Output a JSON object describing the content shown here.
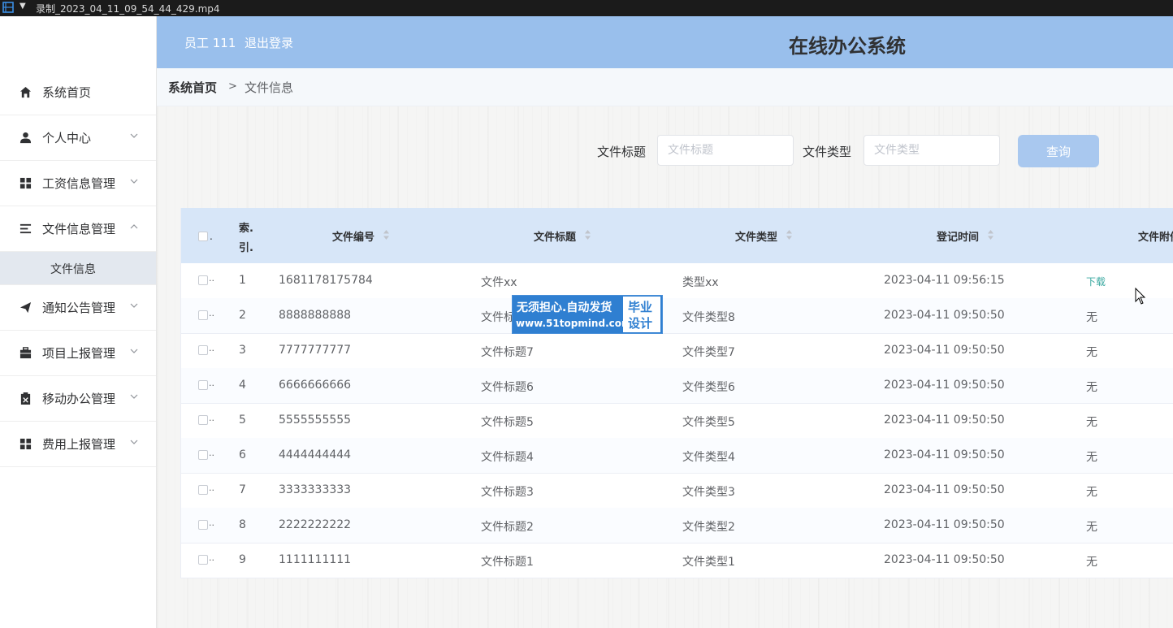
{
  "window": {
    "title": "录制_2023_04_11_09_54_44_429.mp4"
  },
  "header": {
    "user": "员工 111",
    "logout": "退出登录",
    "app_title": "在线办公系统"
  },
  "breadcrumb": {
    "home": "系统首页",
    "separator": ">",
    "current": "文件信息"
  },
  "sidebar": {
    "items": [
      {
        "label": "系统首页",
        "icon": "home-icon"
      },
      {
        "label": "个人中心",
        "icon": "user-icon"
      },
      {
        "label": "工资信息管理",
        "icon": "grid-icon"
      },
      {
        "label": "文件信息管理",
        "icon": "list-icon"
      },
      {
        "label": "通知公告管理",
        "icon": "send-icon"
      },
      {
        "label": "项目上报管理",
        "icon": "briefcase-icon"
      },
      {
        "label": "移动办公管理",
        "icon": "clipboard-icon"
      },
      {
        "label": "费用上报管理",
        "icon": "grid-icon"
      }
    ],
    "submenu": {
      "label": "文件信息"
    }
  },
  "search": {
    "title_label": "文件标题",
    "title_placeholder": "文件标题",
    "type_label": "文件类型",
    "type_placeholder": "文件类型",
    "button": "查询"
  },
  "table": {
    "headers": {
      "index": "索.\n引.",
      "code": "文件编号",
      "title": "文件标题",
      "type": "文件类型",
      "time": "登记时间",
      "attachment": "文件附件"
    },
    "rows": [
      {
        "index": "1",
        "code": "1681178175784",
        "title": "文件xx",
        "type": "类型xx",
        "time": "2023-04-11 09:56:15",
        "attachment": "下载"
      },
      {
        "index": "2",
        "code": "8888888888",
        "title": "文件标题8",
        "type": "文件类型8",
        "time": "2023-04-11 09:50:50",
        "attachment": "无"
      },
      {
        "index": "3",
        "code": "7777777777",
        "title": "文件标题7",
        "type": "文件类型7",
        "time": "2023-04-11 09:50:50",
        "attachment": "无"
      },
      {
        "index": "4",
        "code": "6666666666",
        "title": "文件标题6",
        "type": "文件类型6",
        "time": "2023-04-11 09:50:50",
        "attachment": "无"
      },
      {
        "index": "5",
        "code": "5555555555",
        "title": "文件标题5",
        "type": "文件类型5",
        "time": "2023-04-11 09:50:50",
        "attachment": "无"
      },
      {
        "index": "6",
        "code": "4444444444",
        "title": "文件标题4",
        "type": "文件类型4",
        "time": "2023-04-11 09:50:50",
        "attachment": "无"
      },
      {
        "index": "7",
        "code": "3333333333",
        "title": "文件标题3",
        "type": "文件类型3",
        "time": "2023-04-11 09:50:50",
        "attachment": "无"
      },
      {
        "index": "8",
        "code": "2222222222",
        "title": "文件标题2",
        "type": "文件类型2",
        "time": "2023-04-11 09:50:50",
        "attachment": "无"
      },
      {
        "index": "9",
        "code": "1111111111",
        "title": "文件标题1",
        "type": "文件类型1",
        "time": "2023-04-11 09:50:50",
        "attachment": "无"
      }
    ]
  },
  "watermark": {
    "line1": "无须担心.自动发货",
    "line2": "www.51topmind.com",
    "badge_top": "毕业",
    "badge_bottom": "设计"
  },
  "colors": {
    "header_bg": "#99bfec",
    "table_head_bg": "#d7e6f8",
    "button_bg": "#a9c8ef",
    "link": "#3aa8a0"
  }
}
